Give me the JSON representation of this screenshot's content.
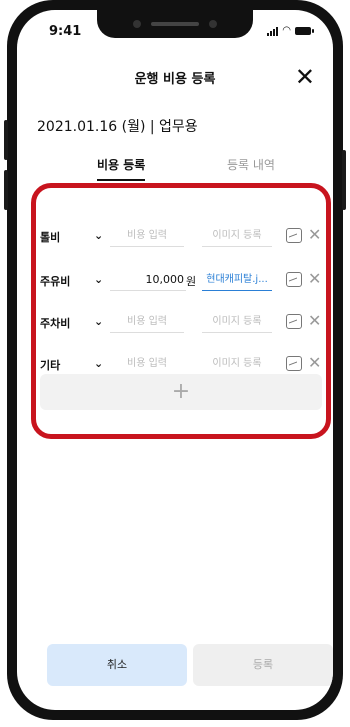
{
  "status_bar": {
    "time": "9:41"
  },
  "header": {
    "title": "운행 비용 등록",
    "close_symbol": "✕"
  },
  "date_line": "2021.01.16 (월) | 업무용",
  "tabs": [
    {
      "label": "비용 등록",
      "active": true
    },
    {
      "label": "등록 내역",
      "active": false
    }
  ],
  "rows": [
    {
      "category": "톨비",
      "amount_placeholder": "비용 입력",
      "amount": "",
      "unit": "",
      "image_placeholder": "이미지 등록",
      "image": ""
    },
    {
      "category": "주유비",
      "amount_placeholder": "비용 입력",
      "amount": "10,000",
      "unit": "원",
      "image_placeholder": "이미지 등록",
      "image": "현대캐피탈.j..."
    },
    {
      "category": "주차비",
      "amount_placeholder": "비용 입력",
      "amount": "",
      "unit": "",
      "image_placeholder": "이미지 등록",
      "image": ""
    },
    {
      "category": "기타",
      "amount_placeholder": "비용 입력",
      "amount": "",
      "unit": "",
      "image_placeholder": "이미지 등록",
      "image": ""
    }
  ],
  "icons": {
    "chevron": "chevron-down-icon",
    "image": "image-icon",
    "delete": "close-icon",
    "add": "plus-icon"
  },
  "add_symbol": "+",
  "buttons": {
    "cancel": "취소",
    "submit": "등록"
  },
  "colors": {
    "highlight_border": "#c8141e",
    "link": "#2a7fd6",
    "cancel_bg": "#d9e9fb"
  }
}
